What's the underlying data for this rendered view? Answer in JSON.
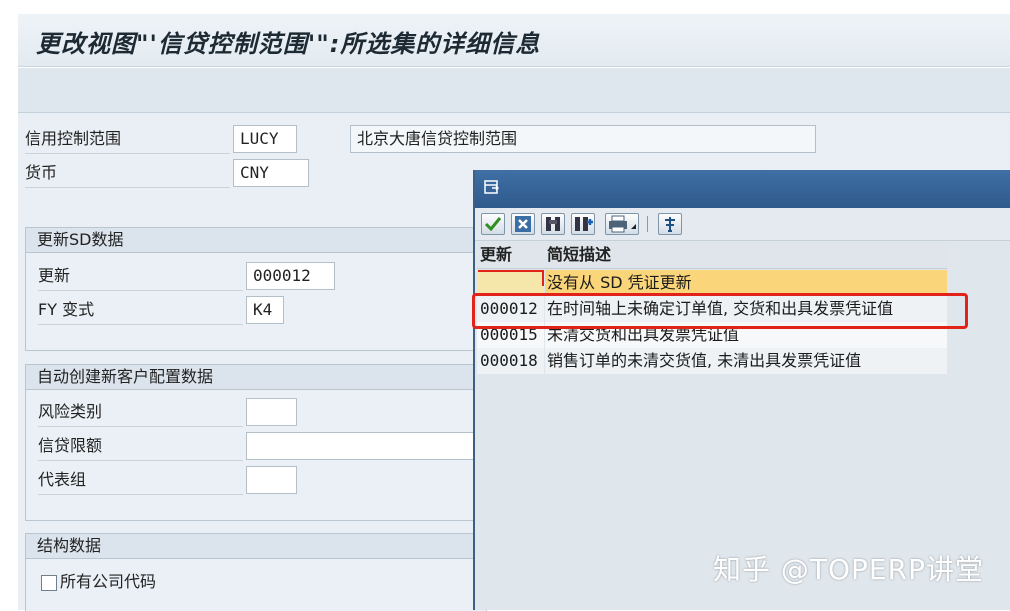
{
  "window": {
    "title": "更改视图\"'信贷控制范围'\":所选集的详细信息"
  },
  "header_fields": {
    "credit_area_label": "信用控制范围",
    "credit_area_value": "LUCY",
    "credit_area_desc": "北京大唐信贷控制范围",
    "currency_label": "货币",
    "currency_value": "CNY"
  },
  "group_sd": {
    "title": "更新SD数据",
    "update_label": "更新",
    "update_value": "000012",
    "fy_label": "FY 变式",
    "fy_value": "K4"
  },
  "group_auto": {
    "title": "自动创建新客户配置数据",
    "risk_label": "风险类别",
    "risk_value": "",
    "limit_label": "信贷限额",
    "limit_value": "",
    "rep_label": "代表组",
    "rep_value": ""
  },
  "group_struct": {
    "title": "结构数据",
    "all_codes_label": "所有公司代码"
  },
  "popup": {
    "toolbar_icons": [
      "check-icon",
      "cancel-icon",
      "find-icon",
      "find-next-icon",
      "print-icon",
      "info-icon"
    ],
    "columns": [
      "更新",
      "简短描述"
    ],
    "rows": [
      {
        "code": "",
        "desc": "没有从 SD 凭证更新"
      },
      {
        "code": "000012",
        "desc": "在时间轴上未确定订单值, 交货和出具发票凭证值"
      },
      {
        "code": "000015",
        "desc": "未清交货和出具发票凭证值"
      },
      {
        "code": "000018",
        "desc": "销售订单的未清交货值, 未清出具发票凭证值"
      }
    ]
  },
  "watermark": "知乎 @TOPERP讲堂",
  "colors": {
    "highlight": "#e2231a",
    "selected_row": "#fbd579",
    "popup_header": "#2f5a8c"
  }
}
